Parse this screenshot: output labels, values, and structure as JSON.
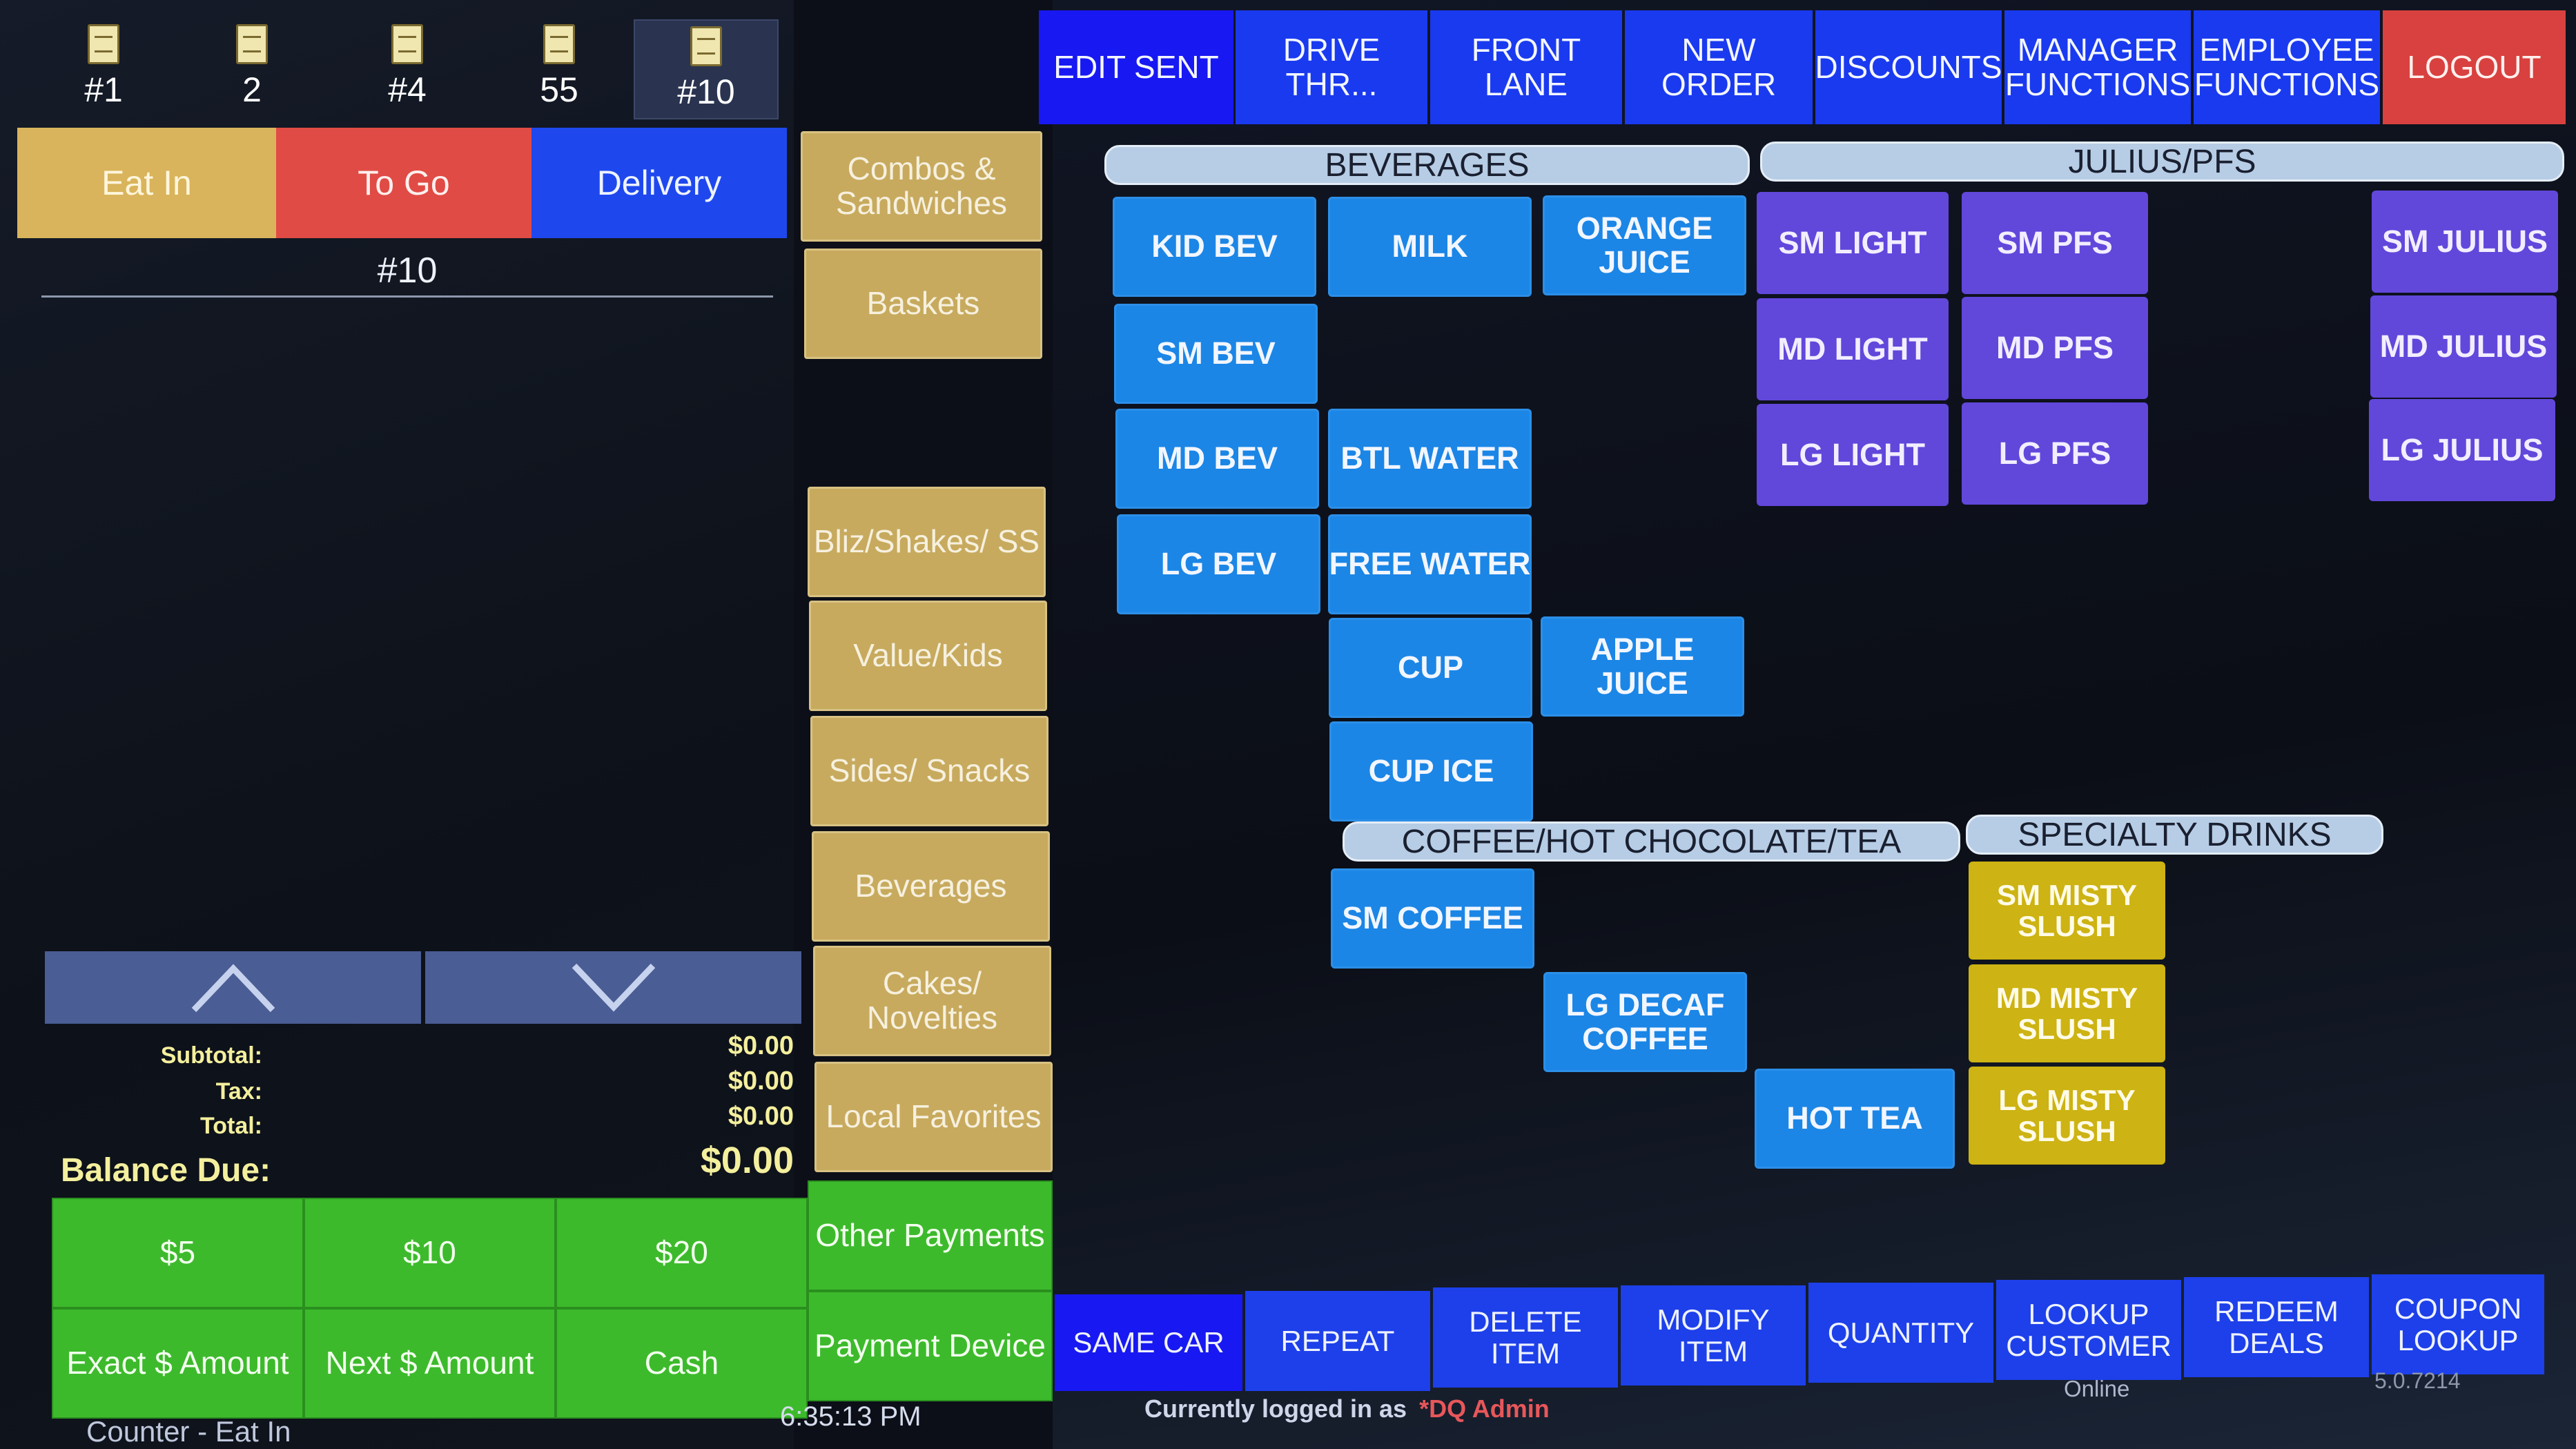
{
  "order_tabs": [
    {
      "label": "#1"
    },
    {
      "label": "2"
    },
    {
      "label": "#4"
    },
    {
      "label": "55"
    },
    {
      "label": "#10"
    }
  ],
  "dine_options": {
    "eat_in": "Eat In",
    "to_go": "To Go",
    "delivery": "Delivery"
  },
  "current_order": "#10",
  "categories": {
    "combos": "Combos & Sandwiches",
    "baskets": "Baskets",
    "blizzards": "Bliz/Shakes/ SS",
    "value": "Value/Kids",
    "sides": "Sides/ Snacks",
    "beverages": "Beverages",
    "cakes": "Cakes/ Novelties",
    "local": "Local Favorites"
  },
  "top_nav": {
    "edit_sent": "EDIT SENT",
    "drive_thru": "DRIVE THR...",
    "front_lane": "FRONT LANE",
    "new_order": "NEW ORDER",
    "discounts": "DISCOUNTS",
    "manager": "MANAGER FUNCTIONS",
    "employee": "EMPLOYEE FUNCTIONS",
    "logout": "LOGOUT"
  },
  "section_headers": {
    "beverages": "BEVERAGES",
    "julius": "JULIUS/PFS",
    "coffee": "COFFEE/HOT CHOCOLATE/TEA",
    "specialty": "SPECIALTY DRINKS"
  },
  "beverage_items": {
    "kid_bev": "KID BEV",
    "milk": "MILK",
    "orange_juice": "ORANGE JUICE",
    "sm_bev": "SM BEV",
    "md_bev": "MD BEV",
    "btl_water": "BTL WATER",
    "lg_bev": "LG BEV",
    "free_water": "FREE WATER",
    "cup": "CUP",
    "apple_juice": "APPLE JUICE",
    "cup_ice": "CUP ICE"
  },
  "julius_items": {
    "sm_light": "SM LIGHT",
    "sm_pfs": "SM PFS",
    "sm_julius": "SM JULIUS",
    "md_light": "MD LIGHT",
    "md_pfs": "MD PFS",
    "md_julius": "MD JULIUS",
    "lg_light": "LG LIGHT",
    "lg_pfs": "LG PFS",
    "lg_julius": "LG JULIUS"
  },
  "coffee_items": {
    "sm_coffee": "SM COFFEE",
    "lg_decaf": "LG DECAF COFFEE",
    "hot_tea": "HOT TEA"
  },
  "specialty_items": {
    "sm_misty": "SM MISTY SLUSH",
    "md_misty": "MD MISTY SLUSH",
    "lg_misty": "LG MISTY SLUSH"
  },
  "totals": {
    "subtotal_label": "Subtotal:",
    "subtotal": "$0.00",
    "tax_label": "Tax:",
    "tax": "$0.00",
    "total_label": "Total:",
    "total": "$0.00",
    "balance_label": "Balance Due:",
    "balance": "$0.00"
  },
  "payments": {
    "five": "$5",
    "ten": "$10",
    "twenty": "$20",
    "other": "Other Payments",
    "exact": "Exact $ Amount",
    "next": "Next $ Amount",
    "cash": "Cash",
    "device": "Payment Device"
  },
  "bottom_nav": {
    "same_car": "SAME CAR",
    "repeat": "REPEAT",
    "delete": "DELETE ITEM",
    "modify": "MODIFY ITEM",
    "quantity": "QUANTITY",
    "lookup_customer": "LOOKUP CUSTOMER",
    "redeem": "REDEEM DEALS",
    "coupon": "COUPON LOOKUP"
  },
  "status": {
    "mode": "Counter - Eat In",
    "time": "6:35:13 PM",
    "logged_prefix": "Currently logged in as",
    "user": "*DQ Admin",
    "online": "Online",
    "version": "5.0.7214"
  },
  "colors": {
    "nav_blue": "#1a3af0",
    "bev_blue": "#1b86e6",
    "julius_purple": "#6247db",
    "misty_yellow": "#cdb313",
    "pay_green": "#3dba2c",
    "logout_red": "#d8413f",
    "eat_in_tan": "#d9b45c",
    "to_go_red": "#e14b45",
    "balance_yellow": "#f4ef9d"
  }
}
